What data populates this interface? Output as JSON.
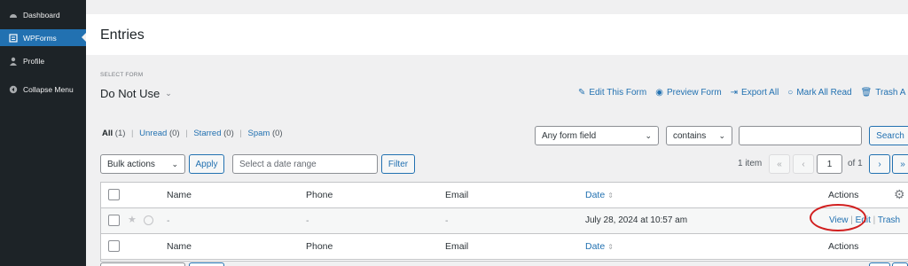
{
  "sidebar": {
    "items": [
      {
        "label": "Dashboard",
        "icon": "dashboard-icon"
      },
      {
        "label": "WPForms",
        "icon": "forms-icon"
      },
      {
        "label": "Profile",
        "icon": "user-icon"
      },
      {
        "label": "Collapse Menu",
        "icon": "collapse-icon"
      }
    ]
  },
  "header": {
    "title": "Entries"
  },
  "select_form": {
    "label": "SELECT FORM",
    "value": "Do Not Use"
  },
  "form_actions": [
    {
      "label": "Edit This Form",
      "icon": "pencil-icon"
    },
    {
      "label": "Preview Form",
      "icon": "eye-icon"
    },
    {
      "label": "Export All",
      "icon": "export-icon"
    },
    {
      "label": "Mark All Read",
      "icon": "circle-icon"
    },
    {
      "label": "Trash A",
      "icon": "trash-icon"
    }
  ],
  "filters": {
    "all": "All",
    "all_count": "(1)",
    "unread": "Unread",
    "unread_count": "(0)",
    "starred": "Starred",
    "starred_count": "(0)",
    "spam": "Spam",
    "spam_count": "(0)",
    "sep": "|"
  },
  "search": {
    "field_select": "Any form field",
    "comparison_select": "contains",
    "value": "",
    "button": "Search"
  },
  "bulk": {
    "select": "Bulk actions",
    "apply": "Apply"
  },
  "date": {
    "placeholder": "Select a date range",
    "filter": "Filter"
  },
  "pagination": {
    "items": "1 item",
    "first": "«",
    "prev": "‹",
    "current": "1",
    "of_total": "of 1",
    "next": "›",
    "last": "»"
  },
  "table": {
    "columns": {
      "name": "Name",
      "phone": "Phone",
      "email": "Email",
      "date": "Date",
      "actions": "Actions"
    },
    "sort_icon": "⇕",
    "rows": [
      {
        "name": "-",
        "phone": "-",
        "email": "-",
        "date": "July 28, 2024 at 10:57 am",
        "view": "View",
        "edit": "Edit",
        "trash": "Trash"
      }
    ]
  },
  "colors": {
    "accent": "#2271b1",
    "sidebar": "#1d2327",
    "highlight": "#d11f1f"
  }
}
